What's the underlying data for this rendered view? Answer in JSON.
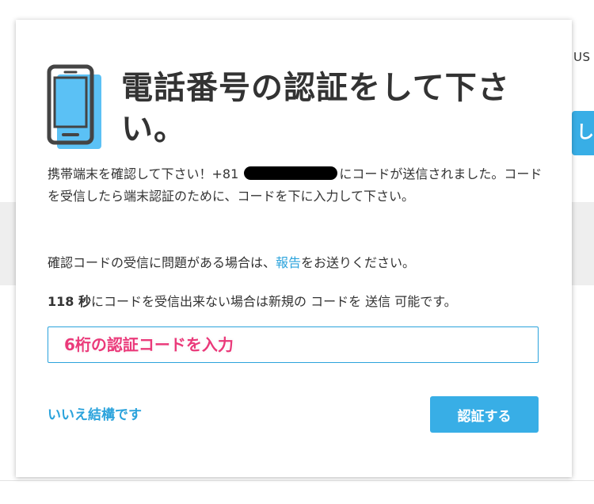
{
  "background": {
    "nav_text": "US",
    "button_text": "し"
  },
  "modal": {
    "title": "電話番号の認証をして下さい。",
    "icon": "smartphone-icon",
    "paragraph1_prefix": "携帯端末を確認して下さい！+81",
    "paragraph1_suffix": "にコードが送信されました。コードを受信したら端末認証のために、コードを下に入力して下さい。",
    "paragraph2_prefix": "確認コードの受信に問題がある場合は、",
    "paragraph2_link": "報告",
    "paragraph2_suffix": "をお送りください。",
    "countdown_value": "118 秒",
    "countdown_text": "にコードを受信出来ない場合は新規の コードを 送信 可能です。",
    "code_input_placeholder": "6桁の認証コードを入力",
    "no_thanks_label": "いいえ結構です",
    "verify_button_label": "認証する"
  },
  "colors": {
    "accent": "#38aee6",
    "link": "#2ba3dc",
    "placeholder": "#ea3a7a",
    "background_band": "#eeeeee"
  }
}
